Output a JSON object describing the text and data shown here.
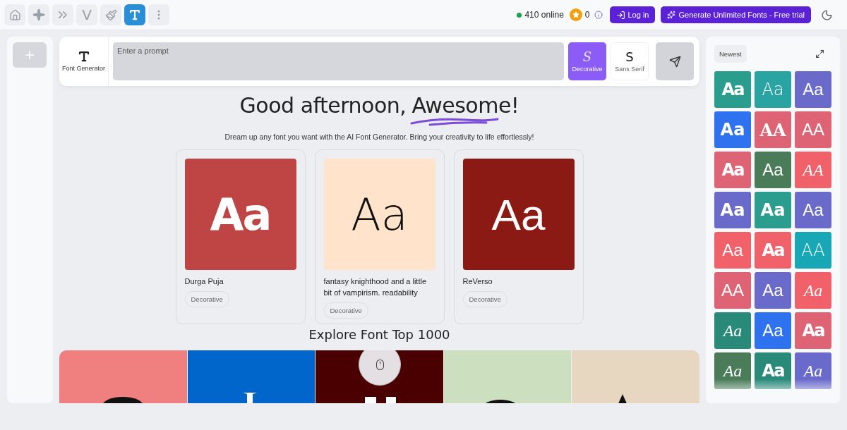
{
  "toolbar": {
    "apps": [
      {
        "kind": "home",
        "selected": false
      },
      {
        "kind": "sparkle",
        "selected": false
      },
      {
        "kind": "chevrons",
        "selected": false
      },
      {
        "kind": "letter",
        "label": "V",
        "selected": false
      },
      {
        "kind": "brush",
        "selected": false
      },
      {
        "kind": "font",
        "selected": true
      },
      {
        "kind": "more",
        "selected": false
      }
    ],
    "online": "410 online",
    "coins": "0",
    "login": "Log in",
    "trial": "Generate Unlimited Fonts - Free trial"
  },
  "prompt": {
    "tool_label": "Font Generator",
    "placeholder": "Enter a prompt",
    "styles": [
      {
        "glyph": "S",
        "label": "Decorative",
        "kind": "script",
        "selected": true
      },
      {
        "glyph": "S",
        "label": "Sans Serif",
        "kind": "sans",
        "selected": false
      }
    ]
  },
  "greeting": {
    "text": "Good afternoon,",
    "name": "Awesome!",
    "subtitle": "Dream up any font you want with the AI Font Generator. Bring your creativity to life effortlessly!"
  },
  "featured": [
    {
      "preview": "Aa",
      "color": "#bf4444",
      "kind": "heavy",
      "title": "Durga Puja",
      "tag": "Decorative"
    },
    {
      "preview": "Aa",
      "color": "#ffe4cb",
      "kind": "thin",
      "title": "fantasy knighthood and a little bit of vampirism. readability",
      "tag": "Decorative"
    },
    {
      "preview": "Aa",
      "color": "#8b1a14",
      "kind": "regular",
      "title": "ReVerso",
      "tag": "Decorative"
    }
  ],
  "explore": {
    "title": "Explore Font Top 1000",
    "tiles": [
      {
        "color": "#f08080"
      },
      {
        "color": "#0066cc"
      },
      {
        "color": "#4a0000"
      },
      {
        "color": "#cce0c0"
      },
      {
        "color": "#e8d7c0"
      }
    ]
  },
  "sidebar": {
    "sort": "Newest",
    "fonts": [
      {
        "preview": "Aa",
        "color": "#2a9d8f",
        "kind": "heavy"
      },
      {
        "preview": "Aa",
        "color": "#2aa3a3",
        "kind": "thin"
      },
      {
        "preview": "Aa",
        "color": "#6a6acb",
        "kind": "regular"
      },
      {
        "preview": "Aa",
        "color": "#2f72f0",
        "kind": "round"
      },
      {
        "preview": "AA",
        "color": "#de6475",
        "kind": "serif"
      },
      {
        "preview": "AA",
        "color": "#de6475",
        "kind": "regular"
      },
      {
        "preview": "Aa",
        "color": "#de6475",
        "kind": "heavy"
      },
      {
        "preview": "Aa",
        "color": "#4a7c59",
        "kind": "regular"
      },
      {
        "preview": "AA",
        "color": "#f0616a",
        "kind": "italic"
      },
      {
        "preview": "Aa",
        "color": "#6a6acb",
        "kind": "round"
      },
      {
        "preview": "Aa",
        "color": "#2a9d8f",
        "kind": "round"
      },
      {
        "preview": "Aa",
        "color": "#6a6acb",
        "kind": "regular"
      },
      {
        "preview": "Aa",
        "color": "#f0616a",
        "kind": "regular"
      },
      {
        "preview": "Aa",
        "color": "#f0616a",
        "kind": "heavy"
      },
      {
        "preview": "AA",
        "color": "#18a7b5",
        "kind": "thin"
      },
      {
        "preview": "AA",
        "color": "#de6475",
        "kind": "regular"
      },
      {
        "preview": "Aa",
        "color": "#6a6acb",
        "kind": "regular"
      },
      {
        "preview": "Aa",
        "color": "#f0616a",
        "kind": "italic"
      },
      {
        "preview": "Aa",
        "color": "#2a8a7a",
        "kind": "italic"
      },
      {
        "preview": "Aa",
        "color": "#2f72f0",
        "kind": "regular"
      },
      {
        "preview": "Aa",
        "color": "#de6475",
        "kind": "heavy"
      },
      {
        "preview": "Aa",
        "color": "#4a7c59",
        "kind": "italic"
      },
      {
        "preview": "Aa",
        "color": "#2a8a7a",
        "kind": "heavy"
      },
      {
        "preview": "Aa",
        "color": "#6a6acb",
        "kind": "italic"
      }
    ]
  }
}
